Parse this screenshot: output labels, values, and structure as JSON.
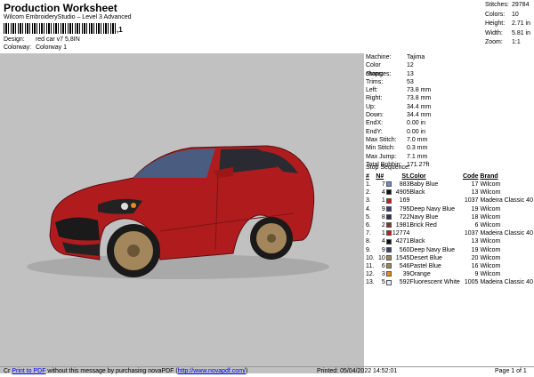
{
  "header": {
    "title": "Production Worksheet",
    "subtitle": "Wilcom EmbroideryStudio – Level 3 Advanced",
    "barcode_tail": ",1",
    "design_label": "Design:",
    "design_value": "red car v7 5,8IN",
    "colorway_label": "Colorway:",
    "colorway_value": "Colorway 1"
  },
  "stats": [
    {
      "k": "Stitches:",
      "v": "29784"
    },
    {
      "k": "Colors:",
      "v": "10"
    },
    {
      "k": "Height:",
      "v": "2.71 in"
    },
    {
      "k": "Width:",
      "v": "5.81 in"
    },
    {
      "k": "Zoom:",
      "v": "1:1"
    }
  ],
  "properties": [
    {
      "k": "Machine:",
      "v": "Tajima"
    },
    {
      "k": "Color changes:",
      "v": "12"
    },
    {
      "k": "Stops:",
      "v": "13"
    },
    {
      "k": "Trims:",
      "v": "53"
    },
    {
      "k": "Left:",
      "v": "73.8 mm"
    },
    {
      "k": "Right:",
      "v": "73.8 mm"
    },
    {
      "k": "Up:",
      "v": "34.4 mm"
    },
    {
      "k": "Down:",
      "v": "34.4 mm"
    },
    {
      "k": "EndX:",
      "v": "0.00 in"
    },
    {
      "k": "EndY:",
      "v": "0.00 in"
    },
    {
      "k": "Max Stitch:",
      "v": "7.0 mm"
    },
    {
      "k": "Min Stitch:",
      "v": "0.3 mm"
    },
    {
      "k": "Max Jump:",
      "v": "7.1 mm"
    },
    {
      "k": "Total Bobbin:",
      "v": "171.27ft"
    }
  ],
  "sequence": {
    "title": "Stop Sequence:",
    "headers": {
      "n": "#",
      "no": "N#",
      "st": "St.",
      "color": "Color",
      "code": "Code",
      "brand": "Brand"
    },
    "rows": [
      {
        "n": "1.",
        "no": "7",
        "sw": "#6d8ec4",
        "st": "883",
        "color": "Baby Blue",
        "code": "17",
        "brand": "Wilcom"
      },
      {
        "n": "2.",
        "no": "4",
        "sw": "#111111",
        "st": "4905",
        "color": "Black",
        "code": "13",
        "brand": "Wilcom"
      },
      {
        "n": "3.",
        "no": "1",
        "sw": "#c3201f",
        "st": "169",
        "color": "",
        "code": "1037",
        "brand": "Madeira Classic 40"
      },
      {
        "n": "4.",
        "no": "9",
        "sw": "#3a3f6a",
        "st": "795",
        "color": "Deep Navy Blue",
        "code": "19",
        "brand": "Wilcom"
      },
      {
        "n": "5.",
        "no": "8",
        "sw": "#2a2f55",
        "st": "722",
        "color": "Navy Blue",
        "code": "18",
        "brand": "Wilcom"
      },
      {
        "n": "6.",
        "no": "2",
        "sw": "#7a3a30",
        "st": "1981",
        "color": "Brick Red",
        "code": "6",
        "brand": "Wilcom"
      },
      {
        "n": "7.",
        "no": "1",
        "sw": "#c3201f",
        "st": "12774",
        "color": "",
        "code": "1037",
        "brand": "Madeira Classic 40"
      },
      {
        "n": "8.",
        "no": "4",
        "sw": "#111111",
        "st": "4271",
        "color": "Black",
        "code": "13",
        "brand": "Wilcom"
      },
      {
        "n": "9.",
        "no": "9",
        "sw": "#3a3f6a",
        "st": "560",
        "color": "Deep Navy Blue",
        "code": "19",
        "brand": "Wilcom"
      },
      {
        "n": "10.",
        "no": "10",
        "sw": "#a4865c",
        "st": "1545",
        "color": "Desert Blue",
        "code": "20",
        "brand": "Wilcom"
      },
      {
        "n": "11.",
        "no": "6",
        "sw": "#9c8a5a",
        "st": "546",
        "color": "Pastel Blue",
        "code": "16",
        "brand": "Wilcom"
      },
      {
        "n": "12.",
        "no": "3",
        "sw": "#e88a1c",
        "st": "39",
        "color": "Orange",
        "code": "9",
        "brand": "Wilcom"
      },
      {
        "n": "13.",
        "no": "5",
        "sw": "#e8ecf5",
        "st": "592",
        "color": "Fluorescent White",
        "code": "1005",
        "brand": "Madeira Classic 40"
      }
    ]
  },
  "footer": {
    "prefix": "Cr",
    "link1": "Print to PDF",
    "middle_text": " without this message by purchasing novaPDF (",
    "link2": "http://www.novapdf.com/",
    "suffix": ")",
    "printed": "Printed: 05/04/2022 14:52:01",
    "page": "Page 1 of 1"
  },
  "colors": {
    "panel_bg": "#c1c1c1",
    "car_body": "#b01c1e",
    "link": "#0000ff"
  }
}
